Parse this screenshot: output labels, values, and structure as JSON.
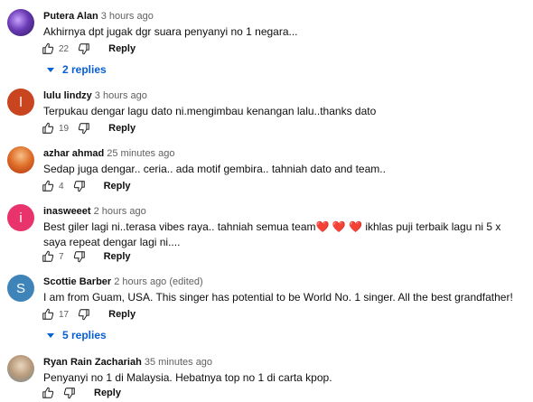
{
  "comments": [
    {
      "author": "Putera Alan",
      "time": "3 hours ago",
      "text": "Akhirnya dpt jugak dgr suara penyanyi no 1 negara...",
      "likes": "22",
      "reply": "Reply",
      "replies": "2 replies",
      "avatar_color": "#5b3aa0",
      "avatar_letter": ""
    },
    {
      "author": "lulu lindzy",
      "time": "3 hours ago",
      "text": "Terpukau dengar lagu dato ni.mengimbau kenangan lalu..thanks dato",
      "likes": "19",
      "reply": "Reply",
      "avatar_color": "#c8451f",
      "avatar_letter": "l"
    },
    {
      "author": "azhar ahmad",
      "time": "25 minutes ago",
      "text": "Sedap juga dengar.. ceria.. ada motif gembira.. tahniah dato and team..",
      "likes": "4",
      "reply": "Reply",
      "avatar_color": "#d9531e",
      "avatar_letter": ""
    },
    {
      "author": "inasweeet",
      "time": "2 hours ago",
      "text_before": "Best giler lagi ni..terasa vibes raya.. tahniah semua team",
      "hearts": "❤️ ❤️ ❤️",
      "text_after": " ikhlas puji  terbaik lagu ni 5 x saya repeat dengar lagi ni....",
      "likes": "7",
      "reply": "Reply",
      "avatar_color": "#e8336d",
      "avatar_letter": "i"
    },
    {
      "author": "Scottie Barber",
      "time": "2 hours ago (edited)",
      "text": "I am from Guam, USA. This singer has potential to be World No. 1 singer. All the best grandfather!",
      "likes": "17",
      "reply": "Reply",
      "replies": "5 replies",
      "avatar_color": "#3f84b8",
      "avatar_letter": "S"
    },
    {
      "author": "Ryan Rain Zachariah",
      "time": "35 minutes ago",
      "text": "Penyanyi no 1 di Malaysia.  Hebatnya top no 1 di carta kpop.",
      "likes": "",
      "reply": "Reply",
      "avatar_color": "#a08a70",
      "avatar_letter": ""
    }
  ],
  "icons": {
    "like": "thumb-up-icon",
    "dislike": "thumb-down-icon",
    "expand": "caret-down-icon"
  }
}
